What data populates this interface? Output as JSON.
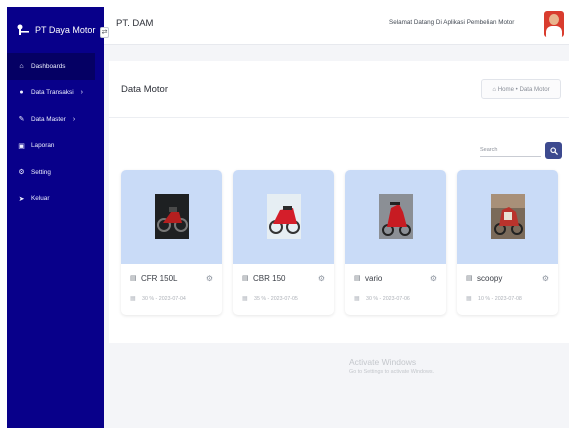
{
  "sidebar": {
    "brand": "PT Daya Motor",
    "items": [
      {
        "label": "Dashboards",
        "icon": "home-icon"
      },
      {
        "label": "Data Transaksi",
        "icon": "dot-icon",
        "chevron": "›"
      },
      {
        "label": "Data Master",
        "icon": "tag-icon",
        "chevron": "›"
      },
      {
        "label": "Laporan",
        "icon": "bag-icon"
      },
      {
        "label": "Setting",
        "icon": "gear-icon"
      },
      {
        "label": "Keluar",
        "icon": "send-icon"
      }
    ]
  },
  "topbar": {
    "title": "PT. DAM",
    "welcome": "Selamat Datang Di Aplikasi Pembelian Motor",
    "toggle": "⇄"
  },
  "page": {
    "title": "Data Motor",
    "breadcrumb": "⌂ Home  •  Data Motor"
  },
  "search": {
    "placeholder": "Search"
  },
  "products": [
    {
      "name": "CFR 150L",
      "meta": "30 % - 2023-07-04"
    },
    {
      "name": "CBR 150",
      "meta": "35 % - 2023-07-05"
    },
    {
      "name": "vario",
      "meta": "30 % - 2023-07-06"
    },
    {
      "name": "scoopy",
      "meta": "10 % - 2023-07-08"
    }
  ],
  "watermark": {
    "line1": "Activate Windows",
    "line2": "Go to Settings to activate Windows."
  },
  "colors": {
    "sidebar": "#08008a",
    "sidebar_active": "#050064",
    "product_bg": "#c9dbf7",
    "search_button": "#3d4a8f"
  }
}
